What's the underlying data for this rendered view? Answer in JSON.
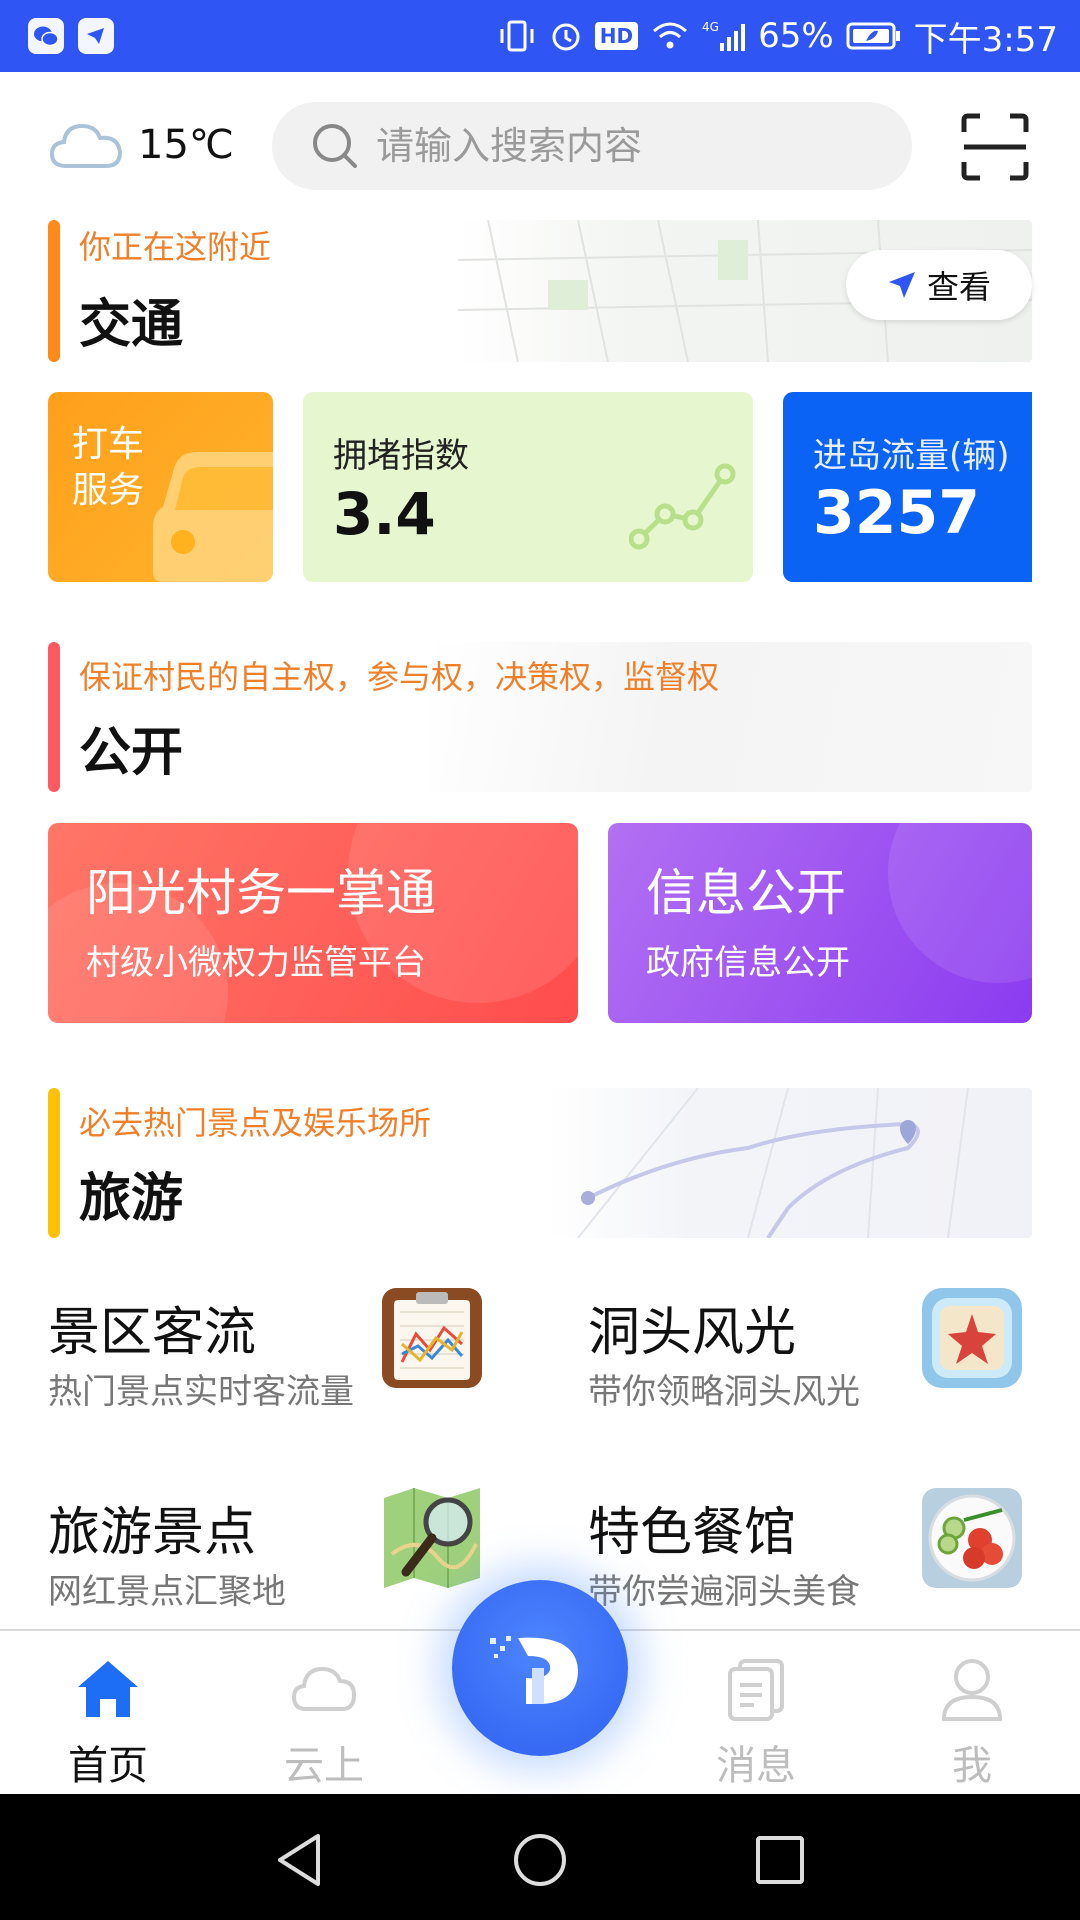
{
  "status_bar": {
    "battery": "65%",
    "time": "下午3:57",
    "network": "4G",
    "hd": "HD"
  },
  "header": {
    "temperature": "15℃",
    "search_placeholder": "请输入搜索内容"
  },
  "traffic": {
    "subtitle": "你正在这附近",
    "title": "交通",
    "view_label": "查看",
    "taxi_label": "打车服务",
    "jam_label": "拥堵指数",
    "jam_value": "3.4",
    "flow_label": "进岛流量(辆)",
    "flow_value": "3257"
  },
  "public": {
    "subtitle": "保证村民的自主权，参与权，决策权，监督权",
    "title": "公开",
    "card1_title": "阳光村务一掌通",
    "card1_sub": "村级小微权力监管平台",
    "card2_title": "信息公开",
    "card2_sub": "政府信息公开"
  },
  "tourism": {
    "subtitle": "必去热门景点及娱乐场所",
    "title": "旅游",
    "items": [
      {
        "title": "景区客流",
        "sub": "热门景点实时客流量"
      },
      {
        "title": "洞头风光",
        "sub": "带你领略洞头风光"
      },
      {
        "title": "旅游景点",
        "sub": "网红景点汇聚地"
      },
      {
        "title": "特色餐馆",
        "sub": "带你尝遍洞头美食"
      }
    ]
  },
  "bottom_nav": {
    "items": [
      {
        "label": "首页",
        "icon": "home-icon",
        "active": true
      },
      {
        "label": "云上",
        "icon": "cloud-icon"
      },
      {
        "label": "消息",
        "icon": "message-icon"
      },
      {
        "label": "我",
        "icon": "user-icon"
      }
    ]
  },
  "colors": {
    "primary": "#2f55f4",
    "accent_orange": "#f07f2a",
    "traffic_bar": "#ff8a1a",
    "public_bar": "#ff5a64",
    "tourism_bar": "#ffc107"
  }
}
